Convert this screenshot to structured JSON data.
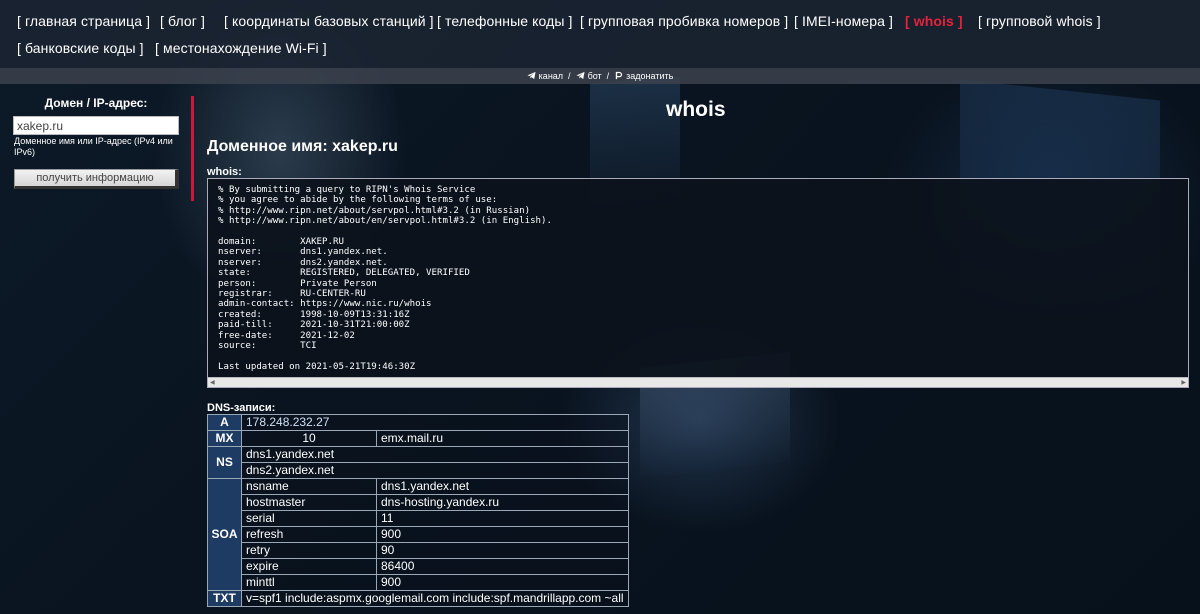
{
  "nav": {
    "items": [
      {
        "label": "[ главная страница ]"
      },
      {
        "label": "[ блог ]"
      },
      {
        "label": "[ координаты базовых станций ]"
      },
      {
        "label": "[ телефонные коды ]"
      },
      {
        "label": "[ групповая пробивка номеров ]"
      },
      {
        "label": "[ IMEI-номера ]"
      },
      {
        "label": "[ whois ]",
        "active": true
      },
      {
        "label": "[ групповой whois ]"
      },
      {
        "label": "[ банковские коды ]"
      },
      {
        "label": "[ местонахождение Wi-Fi ]"
      }
    ],
    "active_color": "#e3223c"
  },
  "subnav": {
    "channel": "канал",
    "bot": "бот",
    "donate": "задонатить",
    "separator": "/"
  },
  "sidebar": {
    "title": "Домен / IP-адрес:",
    "input_value": "xakep.ru",
    "hint": "Доменное имя или IP-адрес (IPv4 или IPv6)",
    "button_label": "получить информацию"
  },
  "main": {
    "page_title": "whois",
    "domain_heading": "Доменное имя: xakep.ru",
    "whois_label": "whois:",
    "whois_text": "% By submitting a query to RIPN's Whois Service\n% you agree to abide by the following terms of use:\n% http://www.ripn.net/about/servpol.html#3.2 (in Russian)\n% http://www.ripn.net/about/en/servpol.html#3.2 (in English).\n\ndomain:        XAKEP.RU\nnserver:       dns1.yandex.net.\nnserver:       dns2.yandex.net.\nstate:         REGISTERED, DELEGATED, VERIFIED\nperson:        Private Person\nregistrar:     RU-CENTER-RU\nadmin-contact: https://www.nic.ru/whois\ncreated:       1998-10-09T13:31:16Z\npaid-till:     2021-10-31T21:00:00Z\nfree-date:     2021-12-02\nsource:        TCI\n\nLast updated on 2021-05-21T19:46:30Z",
    "dns_label": "DNS-записи:"
  },
  "dns": {
    "a": {
      "key": "A",
      "value": "178.248.232.27"
    },
    "mx": {
      "key": "MX",
      "priority": "10",
      "host": "emx.mail.ru"
    },
    "ns": {
      "key": "NS",
      "values": [
        "dns1.yandex.net",
        "dns2.yandex.net"
      ]
    },
    "soa": {
      "key": "SOA",
      "rows": [
        {
          "name": "nsname",
          "value": "dns1.yandex.net"
        },
        {
          "name": "hostmaster",
          "value": "dns-hosting.yandex.ru"
        },
        {
          "name": "serial",
          "value": "11"
        },
        {
          "name": "refresh",
          "value": "900"
        },
        {
          "name": "retry",
          "value": "90"
        },
        {
          "name": "expire",
          "value": "86400"
        },
        {
          "name": "minttl",
          "value": "900"
        }
      ]
    },
    "txt": {
      "key": "TXT",
      "value": "v=spf1 include:aspmx.googlemail.com include:spf.mandrillapp.com ~all"
    }
  }
}
